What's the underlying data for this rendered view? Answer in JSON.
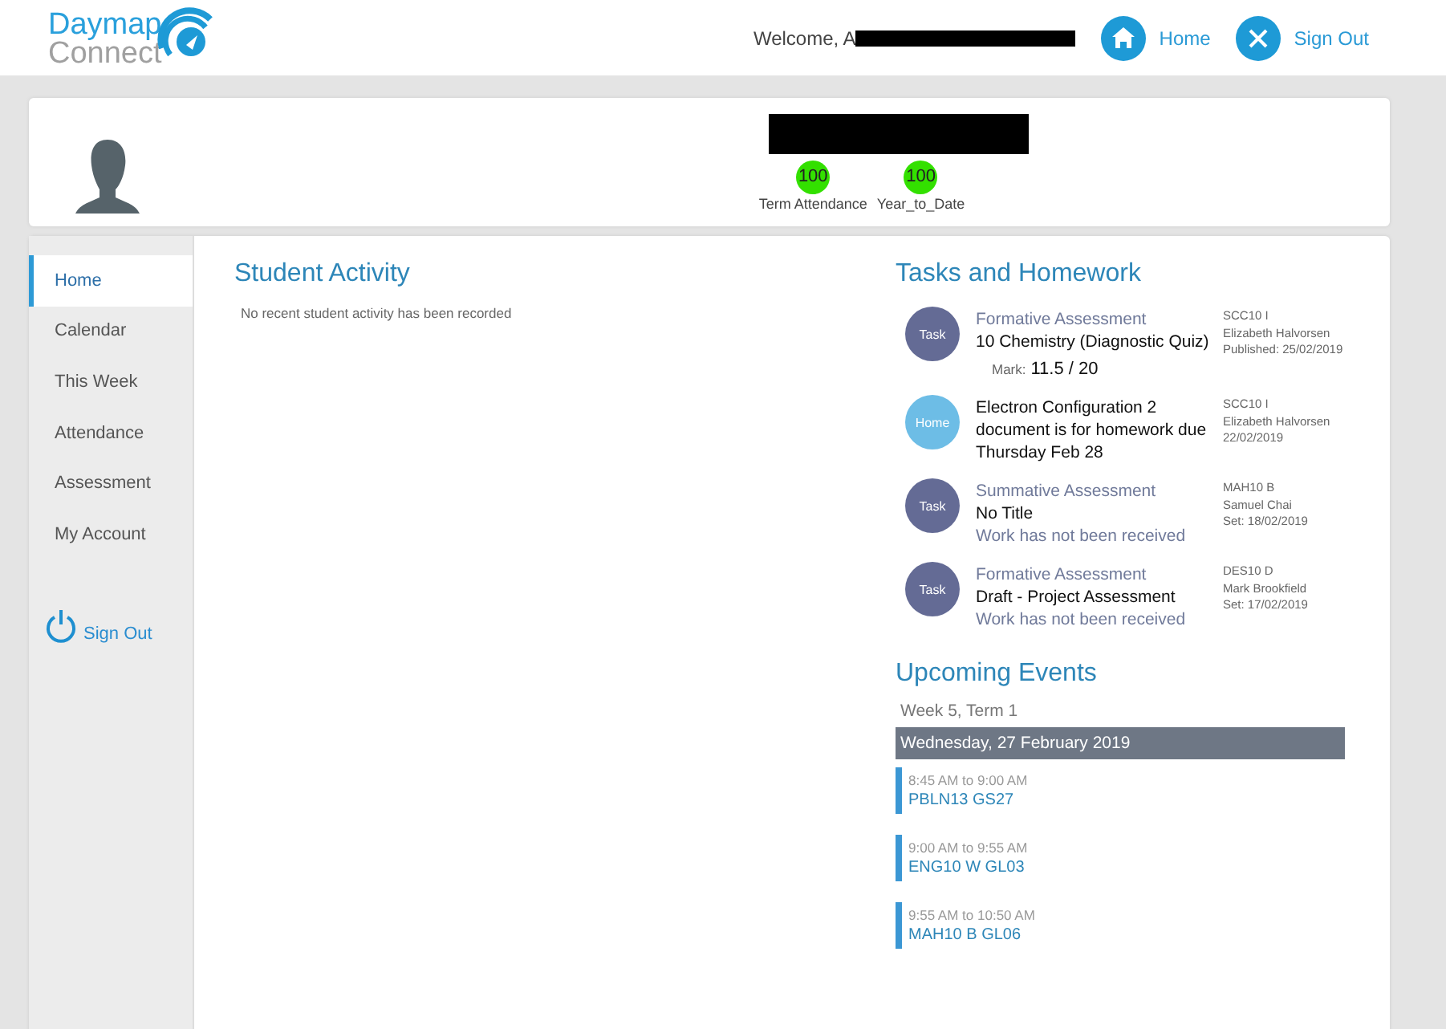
{
  "header": {
    "logo_top": "Daymap",
    "logo_bottom": "Connect",
    "welcome": "Welcome, A",
    "nav": [
      {
        "kind": "home",
        "label": "Home"
      },
      {
        "kind": "close",
        "label": "Sign Out"
      }
    ]
  },
  "profile": {
    "stats": [
      {
        "value": "100",
        "label": "Term Attendance",
        "color": "#33e000"
      },
      {
        "value": "100",
        "label": "Year_to_Date",
        "color": "#33e000"
      }
    ]
  },
  "sidebar": {
    "items": [
      {
        "label": "Home",
        "selected": true
      },
      {
        "label": "Calendar",
        "selected": false
      },
      {
        "label": "This Week",
        "selected": false
      },
      {
        "label": "Attendance",
        "selected": false
      },
      {
        "label": "Assessment",
        "selected": false
      },
      {
        "label": "My Account",
        "selected": false
      }
    ],
    "sign_out": "Sign Out"
  },
  "student_activity": {
    "title": "Student Activity",
    "message": "No recent student activity has been recorded"
  },
  "tasks": {
    "title": "Tasks and Homework",
    "items": [
      {
        "kind": "task",
        "badge": "Task",
        "category": "Formative Assessment",
        "title": "10 Chemistry (Diagnostic Quiz)",
        "mark_label": "Mark:",
        "mark": "11.5 / 20",
        "meta": [
          "SCC10 I",
          "Elizabeth Halvorsen",
          "Published: 25/02/2019"
        ]
      },
      {
        "kind": "home",
        "badge": "Home",
        "title": "Electron Configuration 2 document is for homework due Thursday Feb 28",
        "meta": [
          "SCC10 I",
          "Elizabeth Halvorsen",
          "22/02/2019"
        ]
      },
      {
        "kind": "task",
        "badge": "Task",
        "category": "Summative Assessment",
        "title": "No Title",
        "status": "Work has not been received",
        "meta": [
          "MAH10 B",
          "Samuel Chai",
          "Set: 18/02/2019"
        ]
      },
      {
        "kind": "task",
        "badge": "Task",
        "category": "Formative Assessment",
        "title": "Draft - Project Assessment",
        "status": "Work has not been received",
        "meta": [
          "DES10 D",
          "Mark Brookfield",
          "Set: 17/02/2019"
        ]
      }
    ]
  },
  "events": {
    "title": "Upcoming Events",
    "week": "Week 5, Term 1",
    "day": "Wednesday, 27 February 2019",
    "items": [
      {
        "time": "8:45 AM to 9:00 AM",
        "name": "PBLN13 GS27"
      },
      {
        "time": "9:00 AM to 9:55 AM",
        "name": "ENG10 W GL03"
      },
      {
        "time": "9:55 AM to 10:50 AM",
        "name": "MAH10 B GL06"
      }
    ]
  }
}
